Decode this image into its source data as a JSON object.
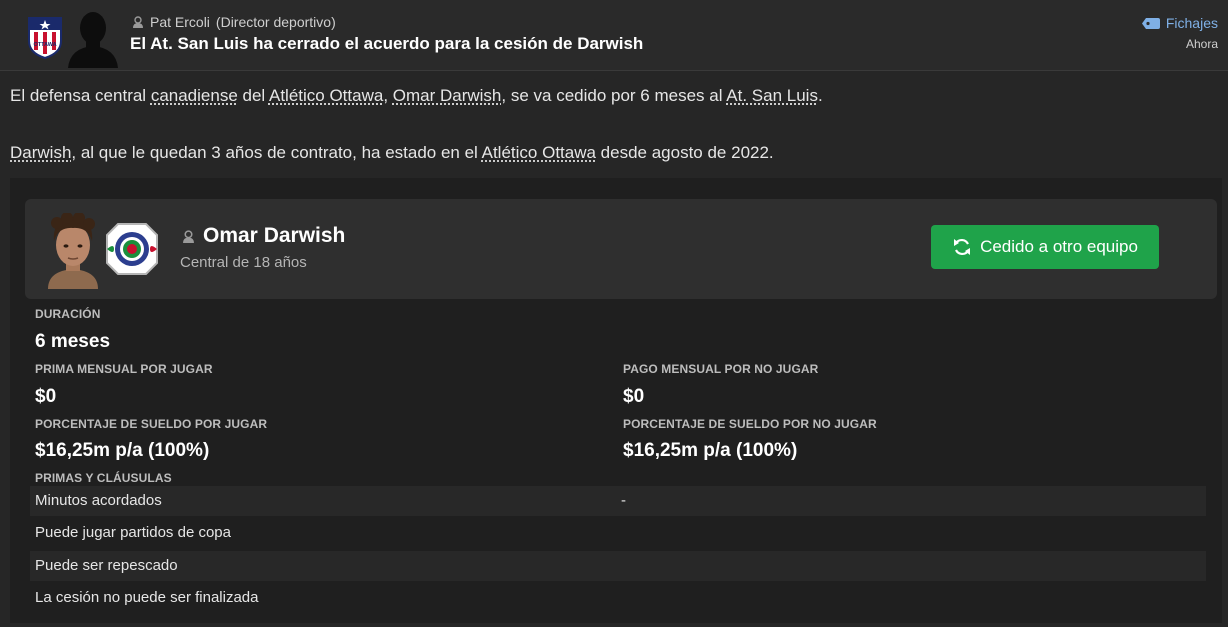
{
  "header": {
    "sender_name": "Pat Ercoli",
    "sender_role": "(Director deportivo)",
    "headline": "El At. San Luis ha cerrado el acuerdo para la cesión de Darwish",
    "tag": "Fichajes",
    "time": "Ahora",
    "crest_text": "OTTAWA"
  },
  "body": {
    "p1": [
      "El defensa central ",
      "canadiense",
      " del ",
      "Atlético Ottawa",
      ", ",
      "Omar Darwish",
      ", se va cedido por 6 meses al ",
      "At. San Luis",
      "."
    ],
    "p2": [
      "Darwish",
      ", al que le quedan 3 años de contrato, ha estado en el ",
      "Atlético Ottawa",
      " desde agosto de 2022."
    ]
  },
  "player": {
    "name": "Omar Darwish",
    "subtitle": "Central de 18 años",
    "status": "Cedido a otro equipo"
  },
  "details": {
    "duration_label": "DURACIÓN",
    "duration_value": "6 meses",
    "bonus_play_label": "PRIMA MENSUAL POR JUGAR",
    "bonus_play_value": "$0",
    "pay_noplay_label": "PAGO MENSUAL POR NO JUGAR",
    "pay_noplay_value": "$0",
    "wage_play_label": "PORCENTAJE DE SUELDO POR JUGAR",
    "wage_play_value": "$16,25m p/a (100%)",
    "wage_noplay_label": "PORCENTAJE DE SUELDO POR NO JUGAR",
    "wage_noplay_value": "$16,25m p/a (100%)",
    "clauses_label": "PRIMAS Y CLÁUSULAS",
    "clauses": [
      {
        "key": "Minutos acordados",
        "value": "-"
      },
      {
        "key": "Puede jugar partidos de copa",
        "value": ""
      },
      {
        "key": "Puede ser repescado",
        "value": ""
      },
      {
        "key": "La cesión no puede ser finalizada",
        "value": ""
      }
    ]
  },
  "colors": {
    "accent_green": "#1fa34a",
    "tag_blue": "#7fb0e6"
  }
}
